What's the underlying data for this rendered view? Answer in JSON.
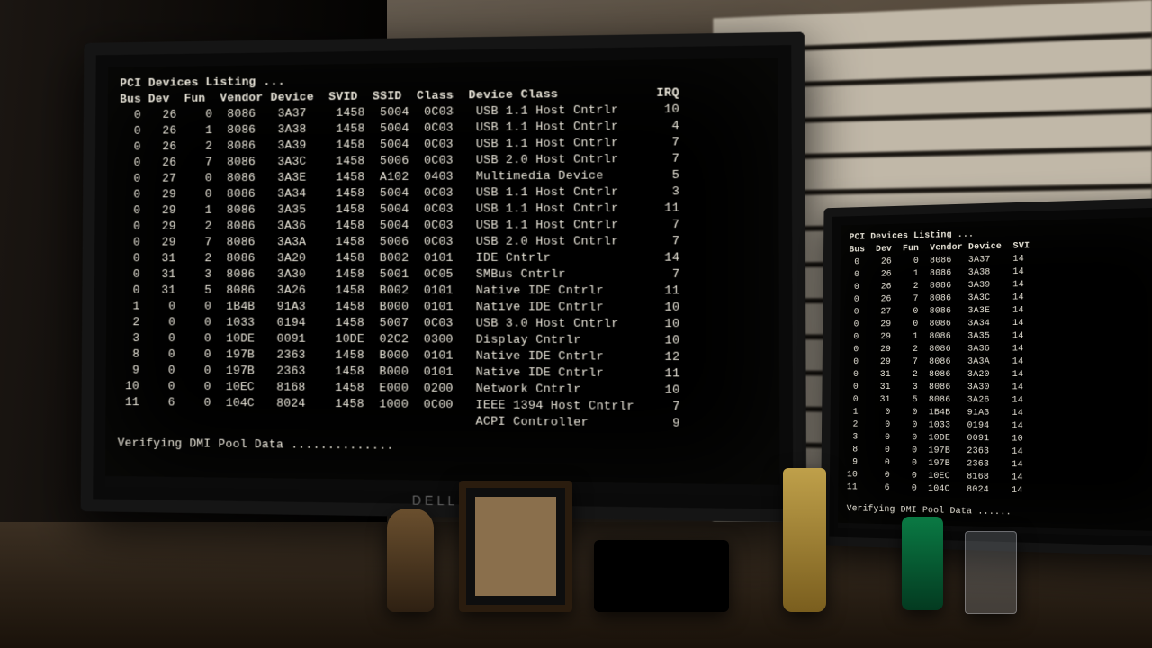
{
  "brand": "DELL",
  "bios": {
    "title": "PCI Devices Listing ...",
    "columns": [
      "Bus",
      "Dev",
      "Fun",
      "Vendor",
      "Device",
      "SVID",
      "SSID",
      "Class",
      "Device Class",
      "IRQ"
    ],
    "rows": [
      {
        "bus": "0",
        "dev": "26",
        "fun": "0",
        "vendor": "8086",
        "device": "3A37",
        "svid": "1458",
        "ssid": "5004",
        "class": "0C03",
        "class_name": "USB 1.1 Host Cntrlr",
        "irq": "10"
      },
      {
        "bus": "0",
        "dev": "26",
        "fun": "1",
        "vendor": "8086",
        "device": "3A38",
        "svid": "1458",
        "ssid": "5004",
        "class": "0C03",
        "class_name": "USB 1.1 Host Cntrlr",
        "irq": "4"
      },
      {
        "bus": "0",
        "dev": "26",
        "fun": "2",
        "vendor": "8086",
        "device": "3A39",
        "svid": "1458",
        "ssid": "5004",
        "class": "0C03",
        "class_name": "USB 1.1 Host Cntrlr",
        "irq": "7"
      },
      {
        "bus": "0",
        "dev": "26",
        "fun": "7",
        "vendor": "8086",
        "device": "3A3C",
        "svid": "1458",
        "ssid": "5006",
        "class": "0C03",
        "class_name": "USB 2.0 Host Cntrlr",
        "irq": "7"
      },
      {
        "bus": "0",
        "dev": "27",
        "fun": "0",
        "vendor": "8086",
        "device": "3A3E",
        "svid": "1458",
        "ssid": "A102",
        "class": "0403",
        "class_name": "Multimedia Device",
        "irq": "5"
      },
      {
        "bus": "0",
        "dev": "29",
        "fun": "0",
        "vendor": "8086",
        "device": "3A34",
        "svid": "1458",
        "ssid": "5004",
        "class": "0C03",
        "class_name": "USB 1.1 Host Cntrlr",
        "irq": "3"
      },
      {
        "bus": "0",
        "dev": "29",
        "fun": "1",
        "vendor": "8086",
        "device": "3A35",
        "svid": "1458",
        "ssid": "5004",
        "class": "0C03",
        "class_name": "USB 1.1 Host Cntrlr",
        "irq": "11"
      },
      {
        "bus": "0",
        "dev": "29",
        "fun": "2",
        "vendor": "8086",
        "device": "3A36",
        "svid": "1458",
        "ssid": "5004",
        "class": "0C03",
        "class_name": "USB 1.1 Host Cntrlr",
        "irq": "7"
      },
      {
        "bus": "0",
        "dev": "29",
        "fun": "7",
        "vendor": "8086",
        "device": "3A3A",
        "svid": "1458",
        "ssid": "5006",
        "class": "0C03",
        "class_name": "USB 2.0 Host Cntrlr",
        "irq": "7"
      },
      {
        "bus": "0",
        "dev": "31",
        "fun": "2",
        "vendor": "8086",
        "device": "3A20",
        "svid": "1458",
        "ssid": "B002",
        "class": "0101",
        "class_name": "IDE Cntrlr",
        "irq": "14"
      },
      {
        "bus": "0",
        "dev": "31",
        "fun": "3",
        "vendor": "8086",
        "device": "3A30",
        "svid": "1458",
        "ssid": "5001",
        "class": "0C05",
        "class_name": "SMBus Cntrlr",
        "irq": "7"
      },
      {
        "bus": "0",
        "dev": "31",
        "fun": "5",
        "vendor": "8086",
        "device": "3A26",
        "svid": "1458",
        "ssid": "B002",
        "class": "0101",
        "class_name": "Native IDE Cntrlr",
        "irq": "11"
      },
      {
        "bus": "1",
        "dev": "0",
        "fun": "0",
        "vendor": "1B4B",
        "device": "91A3",
        "svid": "1458",
        "ssid": "B000",
        "class": "0101",
        "class_name": "Native IDE Cntrlr",
        "irq": "10"
      },
      {
        "bus": "2",
        "dev": "0",
        "fun": "0",
        "vendor": "1033",
        "device": "0194",
        "svid": "1458",
        "ssid": "5007",
        "class": "0C03",
        "class_name": "USB 3.0 Host Cntrlr",
        "irq": "10"
      },
      {
        "bus": "3",
        "dev": "0",
        "fun": "0",
        "vendor": "10DE",
        "device": "0091",
        "svid": "10DE",
        "ssid": "02C2",
        "class": "0300",
        "class_name": "Display Cntrlr",
        "irq": "10"
      },
      {
        "bus": "8",
        "dev": "0",
        "fun": "0",
        "vendor": "197B",
        "device": "2363",
        "svid": "1458",
        "ssid": "B000",
        "class": "0101",
        "class_name": "Native IDE Cntrlr",
        "irq": "12"
      },
      {
        "bus": "9",
        "dev": "0",
        "fun": "0",
        "vendor": "197B",
        "device": "2363",
        "svid": "1458",
        "ssid": "B000",
        "class": "0101",
        "class_name": "Native IDE Cntrlr",
        "irq": "11"
      },
      {
        "bus": "10",
        "dev": "0",
        "fun": "0",
        "vendor": "10EC",
        "device": "8168",
        "svid": "1458",
        "ssid": "E000",
        "class": "0200",
        "class_name": "Network Cntrlr",
        "irq": "10"
      },
      {
        "bus": "11",
        "dev": "6",
        "fun": "0",
        "vendor": "104C",
        "device": "8024",
        "svid": "1458",
        "ssid": "1000",
        "class": "0C00",
        "class_name": "IEEE 1394 Host Cntrlr",
        "irq": "7"
      },
      {
        "bus": "",
        "dev": "",
        "fun": "",
        "vendor": "",
        "device": "",
        "svid": "",
        "ssid": "",
        "class": "",
        "class_name": "ACPI Controller",
        "irq": "9"
      }
    ],
    "status": "Verifying DMI Pool Data .............."
  },
  "side": {
    "title": "PCI Devices Listing ...",
    "header_fragment": "Bus  Dev  Fun  Vendor Device  SVI",
    "status": "Verifying DMI Pool Data ......"
  }
}
